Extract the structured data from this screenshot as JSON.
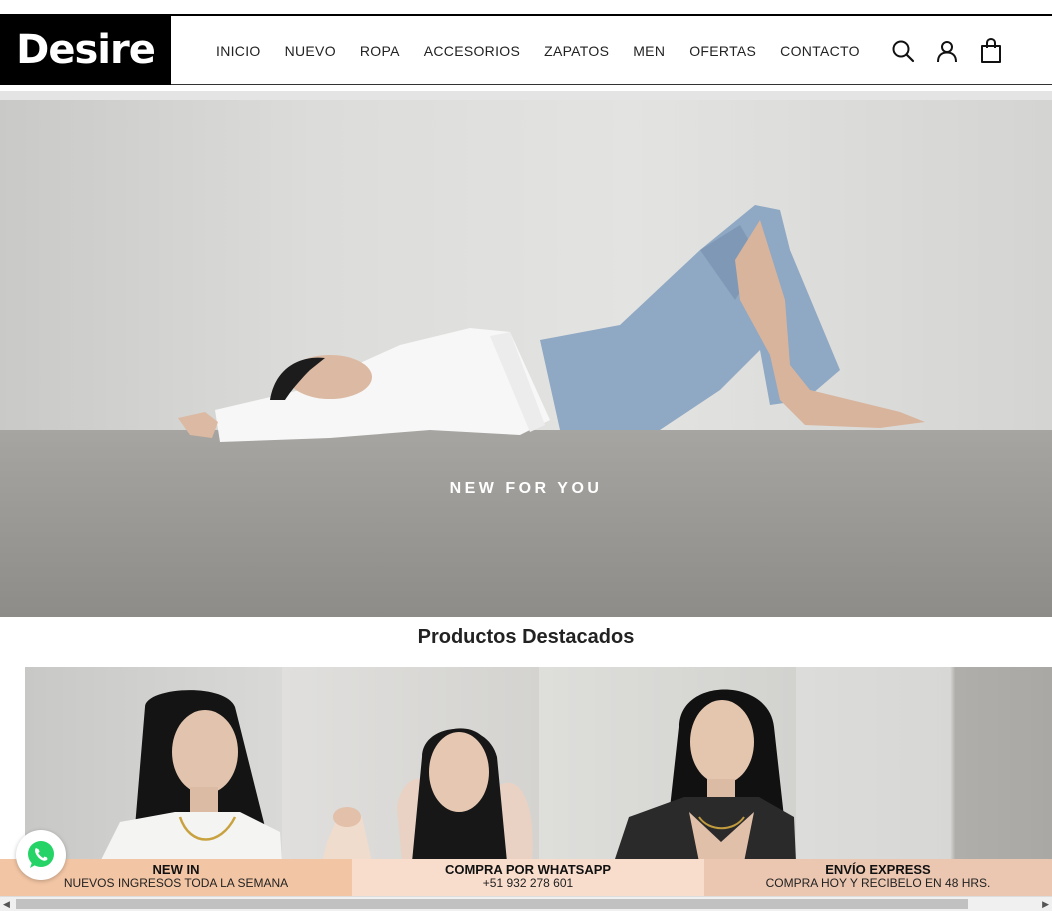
{
  "brand": {
    "logo_text": "Desire"
  },
  "nav": {
    "items": [
      {
        "label": "INICIO"
      },
      {
        "label": "NUEVO"
      },
      {
        "label": "ROPA"
      },
      {
        "label": "ACCESORIOS"
      },
      {
        "label": "ZAPATOS"
      },
      {
        "label": "MEN"
      },
      {
        "label": "OFERTAS"
      },
      {
        "label": "CONTACTO"
      }
    ]
  },
  "header_icons": [
    "search-icon",
    "user-icon",
    "shopping-bag-icon"
  ],
  "hero": {
    "caption": "NEW FOR YOU"
  },
  "featured": {
    "title": "Productos Destacados"
  },
  "promos": [
    {
      "title": "NEW IN",
      "subtitle": "NUEVOS INGRESOS TODA LA SEMANA",
      "color": "#f2c5a4"
    },
    {
      "title": "COMPRA POR WHATSAPP",
      "subtitle": "+51 932 278 601",
      "color": "#f8dccc"
    },
    {
      "title": "ENVÍO EXPRESS",
      "subtitle": "COMPRA HOY Y RECIBELO EN 48 HRS.",
      "color": "#ebc6b0"
    }
  ],
  "whatsapp": {
    "icon": "whatsapp-icon",
    "color": "#25d366"
  }
}
